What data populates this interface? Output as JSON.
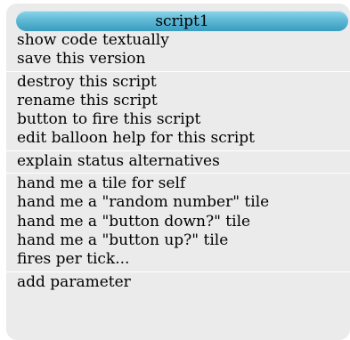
{
  "menu": {
    "title": "script1",
    "groups": [
      {
        "items": [
          "show code textually",
          "save this version"
        ]
      },
      {
        "items": [
          "destroy this script",
          "rename this script",
          "button to fire this script",
          "edit balloon help for this script"
        ]
      },
      {
        "items": [
          "explain status alternatives"
        ]
      },
      {
        "items": [
          "hand me a tile for self",
          "hand me a \"random number\" tile",
          "hand me a \"button down?\" tile",
          "hand me a \"button up?\" tile",
          "fires per tick..."
        ]
      },
      {
        "items": [
          "add parameter"
        ]
      }
    ]
  }
}
